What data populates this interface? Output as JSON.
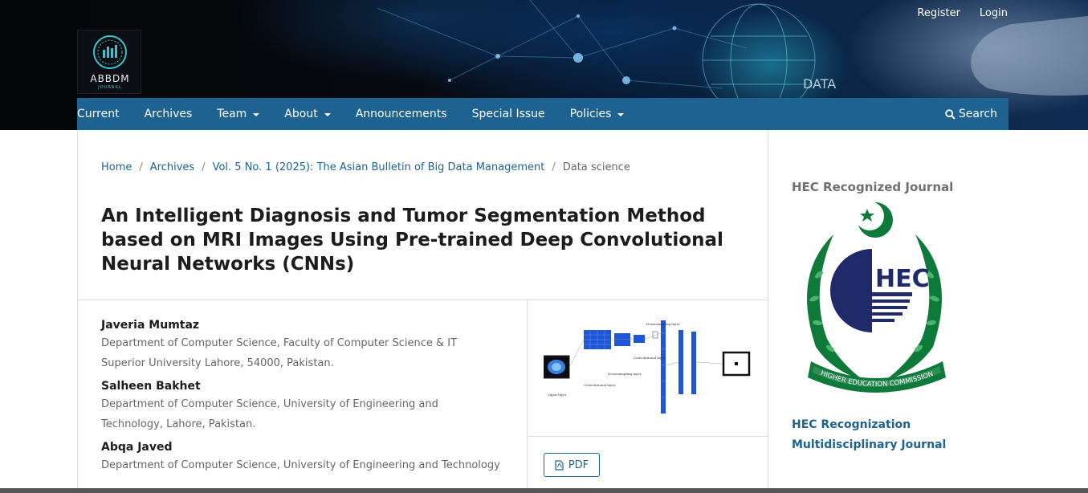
{
  "header": {
    "logo_text": "ABBDM",
    "logo_sub": "JOURNAL",
    "register_label": "Register",
    "login_label": "Login",
    "banner_text": "DATA"
  },
  "nav": {
    "items": [
      {
        "label": "Current"
      },
      {
        "label": "Archives"
      },
      {
        "label": "Team"
      },
      {
        "label": "About"
      },
      {
        "label": "Announcements"
      },
      {
        "label": "Special Issue"
      },
      {
        "label": "Policies"
      }
    ],
    "search_label": "Search"
  },
  "breadcrumb": {
    "home": "Home",
    "archives": "Archives",
    "issue": "Vol. 5 No. 1 (2025): The Asian Bulletin of Big Data Management",
    "current": "Data science"
  },
  "article": {
    "title": "An Intelligent Diagnosis and Tumor Segmentation Method based on MRI Images Using Pre-trained Deep Convolutional Neural Networks (CNNs)",
    "authors": [
      {
        "name": "Javeria Mumtaz",
        "affiliation": "Department of Computer Science, Faculty of Computer Science & IT Superior University Lahore, 54000, Pakistan."
      },
      {
        "name": "Salheen Bakhet",
        "affiliation": "Department of Computer Science, University of Engineering and Technology, Lahore, Pakistan."
      },
      {
        "name": "Abqa Javed",
        "affiliation": "Department of Computer Science, University of Engineering and Technology"
      }
    ],
    "pdf_label": "PDF",
    "figure_labels": {
      "downsampling_1": "Downsampling layer",
      "convolutional_1": "Convolutional layer",
      "downsampling_2": "Downsampling layer",
      "convolutional_2": "Convolutional layer",
      "input": "Input layer"
    }
  },
  "sidebar": {
    "heading": "HEC Recognized Journal",
    "hec_letters": "HEC",
    "hec_ribbon": "HIGHER EDUCATION COMMISSION",
    "link1": "HEC Recognization",
    "link2": "Multidisciplinary Journal"
  },
  "colors": {
    "nav_bg": "#1e6292",
    "link": "#1e6292",
    "hec_green": "#0e7a3a",
    "hec_navy": "#1f2a6b"
  }
}
